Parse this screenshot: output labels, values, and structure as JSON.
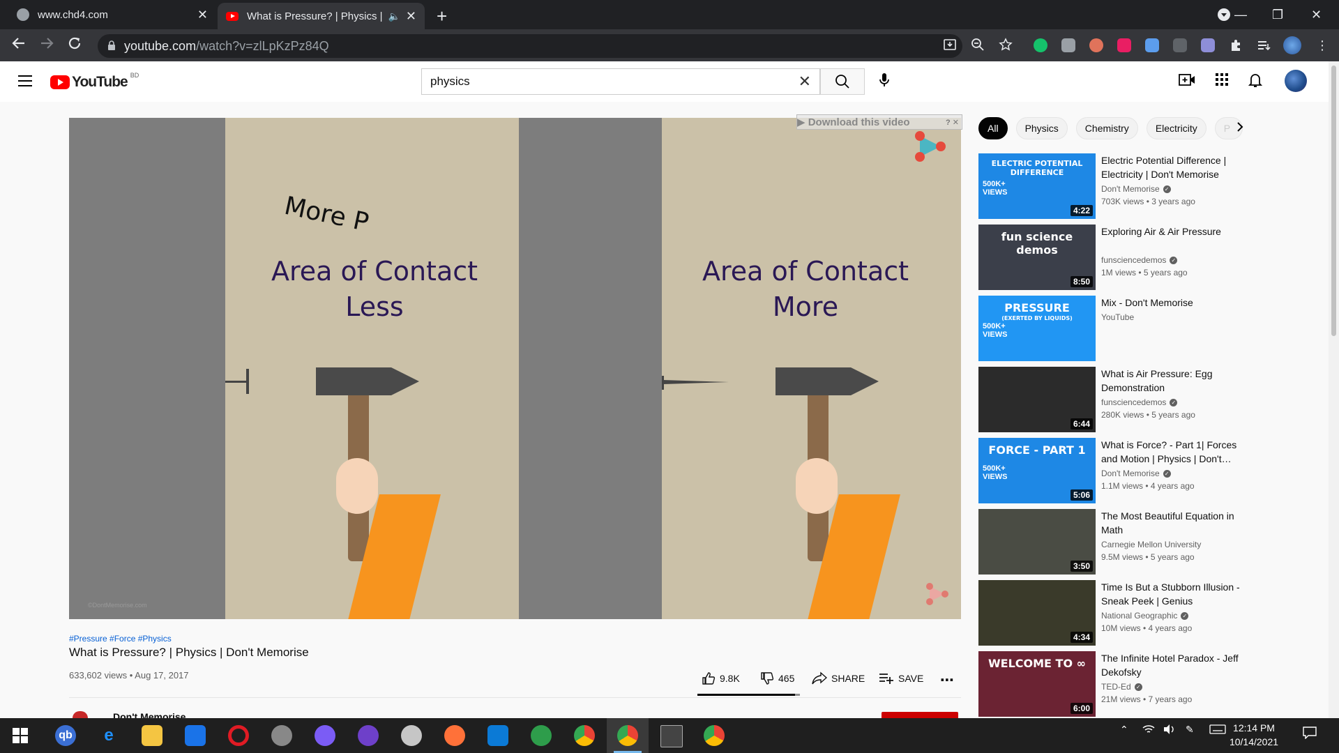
{
  "browser": {
    "tabs": [
      {
        "title": "www.chd4.com",
        "close": "✕"
      },
      {
        "title": "What is Pressure? | Physics | Don't Memorise",
        "audio": "🔈",
        "close": "✕"
      }
    ],
    "new_tab": "+",
    "url_host": "youtube.com",
    "url_path": "/watch?v=zlLpKzPz84Q",
    "window_controls": {
      "minimize": "—",
      "restore": "❐",
      "close": "✕"
    }
  },
  "youtube": {
    "logo_text": "YouTube",
    "country_code": "BD",
    "search_value": "physics",
    "search_clear": "✕"
  },
  "player": {
    "download_banner": "▶ Download this video",
    "download_banner_close": "? ✕",
    "left_heading": [
      "Area of Contact",
      "Less"
    ],
    "right_heading": [
      "Area of Contact",
      "More"
    ],
    "arc_text": "More P",
    "watermark": "©DontMemorise.com"
  },
  "video": {
    "hashtags": "#Pressure #Force #Physics",
    "title": "What is Pressure? | Physics | Don't Memorise",
    "meta": "633,602 views • Aug 17, 2017",
    "likes": "9.8K",
    "dislikes": "465",
    "like_fraction": 0.955,
    "share": "SHARE",
    "save": "SAVE",
    "more": "⋯",
    "channel_name_peek": "Don't Memorise"
  },
  "chips": [
    "All",
    "Physics",
    "Chemistry",
    "Electricity",
    "P"
  ],
  "recommendations": [
    {
      "title": "Electric Potential Difference | Electricity | Don't Memorise",
      "channel": "Don't Memorise",
      "verified": true,
      "meta": "703K views • 3 years ago",
      "duration": "4:22",
      "thumb_text": "ELECTRIC POTENTIAL DIFFERENCE",
      "badge": "500K+ VIEWS",
      "bg": "#1e88e5"
    },
    {
      "title": "Exploring Air & Air Pressure",
      "channel": "funsciencedemos",
      "verified": true,
      "meta": "1M views • 5 years ago",
      "duration": "8:50",
      "thumb_text": "fun science demos",
      "badge": "",
      "bg": "#3b3f4a"
    },
    {
      "title": "Mix - Don't Memorise",
      "channel": "YouTube",
      "verified": false,
      "meta": "",
      "duration": "",
      "thumb_text": "PRESSURE",
      "badge": "500K+ VIEWS",
      "sub_text": "(EXERTED BY LIQUIDS)",
      "bg": "#2196f3"
    },
    {
      "title": "What is Air Pressure: Egg Demonstration",
      "channel": "funsciencedemos",
      "verified": true,
      "meta": "280K views • 5 years ago",
      "duration": "6:44",
      "thumb_text": "",
      "badge": "",
      "bg": "#2b2b2b"
    },
    {
      "title": "What is Force? - Part 1| Forces and Motion | Physics | Don't…",
      "channel": "Don't Memorise",
      "verified": true,
      "meta": "1.1M views • 4 years ago",
      "duration": "5:06",
      "thumb_text": "FORCE - PART 1",
      "badge": "500K+ VIEWS",
      "bg": "#1e88e5"
    },
    {
      "title": "The Most Beautiful Equation in Math",
      "channel": "Carnegie Mellon University",
      "verified": false,
      "meta": "9.5M views • 5 years ago",
      "duration": "3:50",
      "thumb_text": "",
      "badge": "",
      "bg": "#4a4c44"
    },
    {
      "title": "Time Is But a Stubborn Illusion - Sneak Peek | Genius",
      "channel": "National Geographic",
      "verified": true,
      "meta": "10M views • 4 years ago",
      "duration": "4:34",
      "thumb_text": "",
      "badge": "",
      "bg": "#3a3a2a"
    },
    {
      "title": "The Infinite Hotel Paradox - Jeff Dekofsky",
      "channel": "TED-Ed",
      "verified": true,
      "meta": "21M views • 7 years ago",
      "duration": "6:00",
      "thumb_text": "WELCOME TO ∞",
      "badge": "",
      "bg": "#6b2333"
    }
  ],
  "taskbar": {
    "time": "12:14 PM",
    "date": "10/14/2021",
    "apps": [
      "start",
      "qb",
      "edge",
      "explorer",
      "mail",
      "opera",
      "satellite",
      "messenger",
      "github",
      "paint",
      "firefox",
      "vscode",
      "earth",
      "chrome",
      "chrome-active",
      "terminal",
      "chrome-ek"
    ]
  }
}
